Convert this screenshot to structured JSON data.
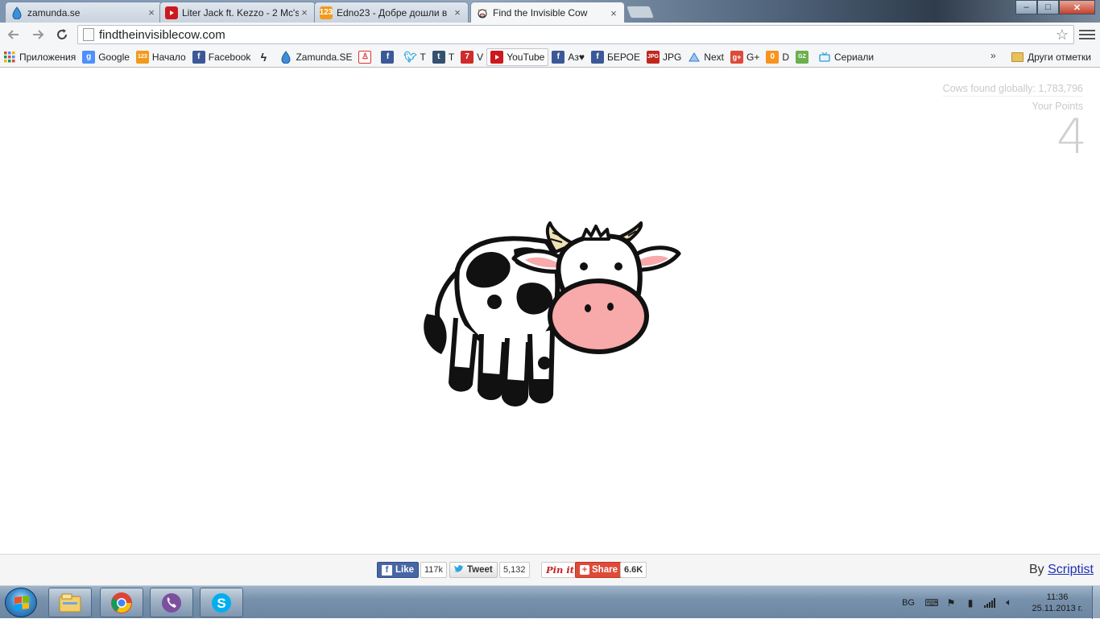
{
  "browser": {
    "tabs": [
      {
        "label": "zamunda.se",
        "icon": "zamunda-icon"
      },
      {
        "label": "Liter Jack ft. Kezzo - 2 Mc's",
        "icon": "youtube-icon"
      },
      {
        "label": "Edno23 - Добре дошли в",
        "icon": "edno23-icon"
      },
      {
        "label": "Find the Invisible Cow",
        "icon": "cow-icon",
        "active": true
      }
    ],
    "close_glyph": "×",
    "url": "findtheinvisiblecow.com",
    "window_buttons": {
      "minimize": "–",
      "maximize": "□",
      "close": "✕"
    }
  },
  "bookmarks": {
    "items": [
      {
        "label": "Приложения",
        "icon": "apps-grid-icon"
      },
      {
        "label": "Google",
        "icon": "google-icon"
      },
      {
        "label": "Начало",
        "icon": "edno23-icon"
      },
      {
        "label": "Facebook",
        "icon": "facebook-icon"
      },
      {
        "label": "",
        "icon": "lightning-icon"
      },
      {
        "label": "Zamunda.SE",
        "icon": "zamunda-icon"
      },
      {
        "label": "",
        "icon": "person-icon"
      },
      {
        "label": "",
        "icon": "facebook-icon"
      },
      {
        "label": "T",
        "icon": "twitter-icon"
      },
      {
        "label": "T",
        "icon": "tumblr-icon"
      },
      {
        "label": "V",
        "icon": "seven-icon"
      },
      {
        "label": "YouTube",
        "icon": "youtube-icon"
      },
      {
        "label": "Аз♥",
        "icon": "facebook-icon"
      },
      {
        "label": "БЕРОЕ",
        "icon": "facebook-icon"
      },
      {
        "label": "JPG",
        "icon": "jpg-icon"
      },
      {
        "label": "Next",
        "icon": "next-icon"
      },
      {
        "label": "G+",
        "icon": "google-plus-icon"
      },
      {
        "label": "D",
        "icon": "odnoklassniki-icon"
      },
      {
        "label": "",
        "icon": "gamezone-icon"
      },
      {
        "label": "Сериали",
        "icon": "tv-icon"
      }
    ],
    "more": "»",
    "other": "Други отметки"
  },
  "page": {
    "cows_found": "Cows found globally: 1,783,796",
    "your_points_label": "Your Points",
    "your_points": "4"
  },
  "share": {
    "like_label": "Like",
    "like_count": "117k",
    "tweet_label": "Tweet",
    "tweet_count": "5,132",
    "pin_label": "Pin it",
    "share_label": "Share",
    "share_count": "6.6K",
    "by": "By",
    "author": "Scriptist"
  },
  "taskbar": {
    "lang": "BG",
    "time": "11:36",
    "date": "25.11.2013 г.",
    "apps": [
      "explorer-icon",
      "chrome-icon",
      "viber-icon",
      "skype-icon"
    ]
  },
  "colors": {
    "facebook": "#4866a4",
    "twitter": "#2ba6e1",
    "pinterest": "#cb2027",
    "google_share": "#dd4b39",
    "cow_nose": "#f8a9a9"
  }
}
